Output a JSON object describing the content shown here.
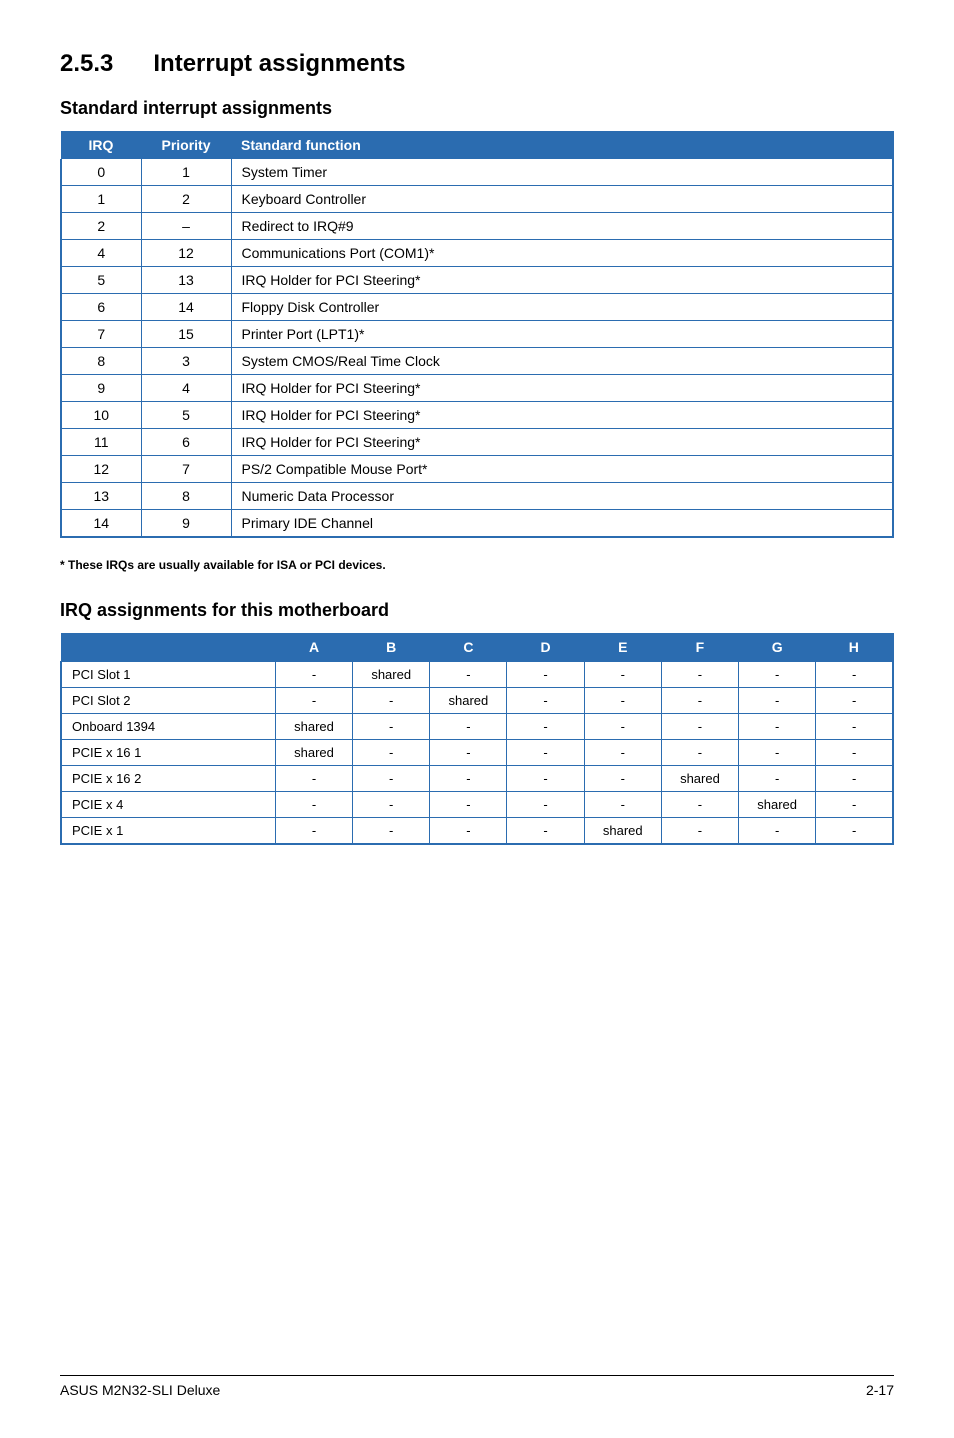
{
  "section": {
    "number": "2.5.3",
    "title": "Interrupt assignments"
  },
  "subsection1": {
    "title": "Standard interrupt assignments",
    "headers": {
      "irq": "IRQ",
      "priority": "Priority",
      "func": "Standard function"
    },
    "rows": [
      {
        "irq": "0",
        "priority": "1",
        "func": "System Timer"
      },
      {
        "irq": "1",
        "priority": "2",
        "func": "Keyboard Controller"
      },
      {
        "irq": "2",
        "priority": "–",
        "func": "Redirect to IRQ#9"
      },
      {
        "irq": "4",
        "priority": "12",
        "func": "Communications Port (COM1)*"
      },
      {
        "irq": "5",
        "priority": "13",
        "func": "IRQ Holder for PCI Steering*"
      },
      {
        "irq": "6",
        "priority": "14",
        "func": "Floppy Disk Controller"
      },
      {
        "irq": "7",
        "priority": "15",
        "func": "Printer Port (LPT1)*"
      },
      {
        "irq": "8",
        "priority": "3",
        "func": "System CMOS/Real Time Clock"
      },
      {
        "irq": "9",
        "priority": "4",
        "func": "IRQ Holder for PCI Steering*"
      },
      {
        "irq": "10",
        "priority": "5",
        "func": "IRQ Holder for PCI Steering*"
      },
      {
        "irq": "11",
        "priority": "6",
        "func": "IRQ Holder for PCI Steering*"
      },
      {
        "irq": "12",
        "priority": "7",
        "func": "PS/2 Compatible Mouse Port*"
      },
      {
        "irq": "13",
        "priority": "8",
        "func": "Numeric Data Processor"
      },
      {
        "irq": "14",
        "priority": "9",
        "func": "Primary IDE Channel"
      }
    ],
    "footnote": "* These IRQs are usually available for ISA or PCI devices."
  },
  "subsection2": {
    "title": "IRQ assignments for this motherboard",
    "columns": [
      "A",
      "B",
      "C",
      "D",
      "E",
      "F",
      "G",
      "H"
    ],
    "rows": [
      {
        "name": "PCI Slot 1",
        "cells": [
          "-",
          "shared",
          "-",
          "-",
          "-",
          "-",
          "-",
          "-"
        ]
      },
      {
        "name": "PCI Slot 2",
        "cells": [
          "-",
          "-",
          "shared",
          "-",
          "-",
          "-",
          "-",
          "-"
        ]
      },
      {
        "name": "Onboard 1394",
        "cells": [
          "shared",
          "-",
          "-",
          "-",
          "-",
          "-",
          "-",
          "-"
        ]
      },
      {
        "name": "PCIE x 16 1",
        "cells": [
          "shared",
          "-",
          "-",
          "-",
          "-",
          "-",
          "-",
          "-"
        ]
      },
      {
        "name": "PCIE x 16 2",
        "cells": [
          "-",
          "-",
          "-",
          "-",
          "-",
          "shared",
          "-",
          "-"
        ]
      },
      {
        "name": "PCIE x 4",
        "cells": [
          "-",
          "-",
          "-",
          "-",
          "-",
          "-",
          "shared",
          "-"
        ]
      },
      {
        "name": "PCIE x 1",
        "cells": [
          "-",
          "-",
          "-",
          "-",
          "shared",
          "-",
          "-",
          "-"
        ]
      }
    ]
  },
  "footer": {
    "left": "ASUS M2N32-SLI Deluxe",
    "right": "2-17"
  }
}
